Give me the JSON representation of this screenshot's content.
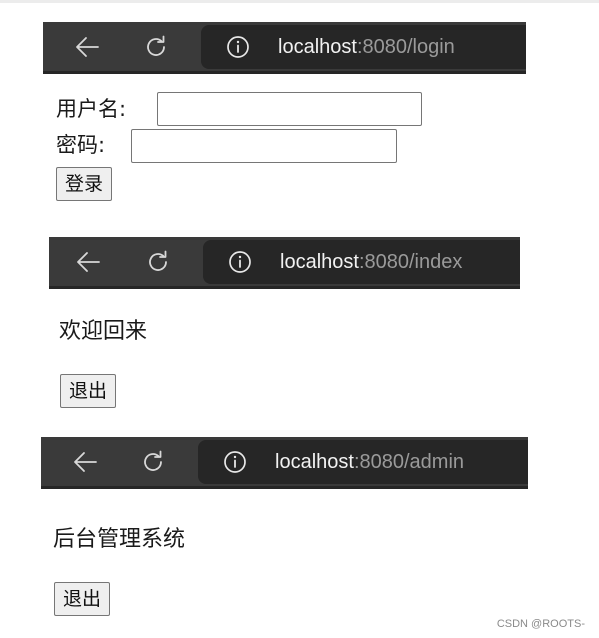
{
  "login_view": {
    "url_host": "localhost",
    "url_rest": ":8080/login",
    "username_label": "用户名:",
    "password_label": "密码:",
    "username_value": "",
    "password_value": "",
    "login_button": "登录"
  },
  "index_view": {
    "url_host": "localhost",
    "url_rest": ":8080/index",
    "welcome_text": "欢迎回来",
    "logout_button": "退出"
  },
  "admin_view": {
    "url_host": "localhost",
    "url_rest": ":8080/admin",
    "heading": "后台管理系统",
    "logout_button": "退出"
  },
  "icons": {
    "back": "back-arrow-icon",
    "reload": "reload-icon",
    "info": "info-icon"
  },
  "colors": {
    "toolbar_bg": "#3a3a3a",
    "omnibox_bg": "#262626",
    "url_host_color": "#f2f2f2",
    "url_path_color": "#9a9a9a",
    "button_bg": "#efefef"
  },
  "watermark": "CSDN @ROOTS-"
}
